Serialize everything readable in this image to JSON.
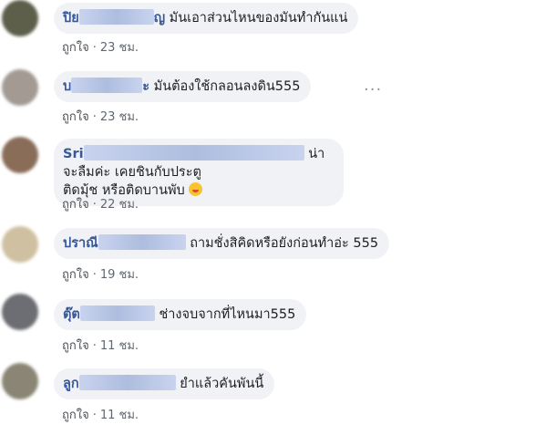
{
  "comments": [
    {
      "name": "ปิย",
      "name_suffix": "ญ",
      "text": "มันเอาส่วนไหนของมันทำกันแน่",
      "like_label": "ถูกใจ",
      "time": "23 ชม.",
      "avatar_color": "#5d5f4a"
    },
    {
      "name": "บ",
      "name_suffix": "ะ",
      "text": "มันต้องใช้กลอนลงดิน555",
      "like_label": "ถูกใจ",
      "time": "23 ชม.",
      "avatar_color": "#a29a93"
    },
    {
      "name": "Sri",
      "name_suffix": "",
      "text_line1": "น่าจะลืมค่ะ เคยชินกับประตู",
      "text_line2": "ติดมุ้ช หรือติดบานพับ",
      "like_label": "ถูกใจ",
      "time": "22 ชม.",
      "avatar_color": "#8a6d59"
    },
    {
      "name": "ปราณี",
      "name_suffix": "",
      "text": "ถามชั่งสิคิดหรือยังก่อนทำอ่ะ 555",
      "like_label": "ถูกใจ",
      "time": "19 ชม.",
      "avatar_color": "#cfc0a2"
    },
    {
      "name": "ตุ๊ต",
      "name_suffix": "",
      "text": "ช่างจบจากที่ไหนมา555",
      "like_label": "ถูกใจ",
      "time": "11 ชม.",
      "avatar_color": "#6c6e73"
    },
    {
      "name": "ลูก",
      "name_suffix": "",
      "text": "ยำแล้วคันพันนี้",
      "like_label": "ถูกใจ",
      "time": "11 ชม.",
      "avatar_color": "#8a8574"
    }
  ],
  "more_options_icon": "ellipsis-icon",
  "emoji_icon": "laughing-emoji-icon"
}
